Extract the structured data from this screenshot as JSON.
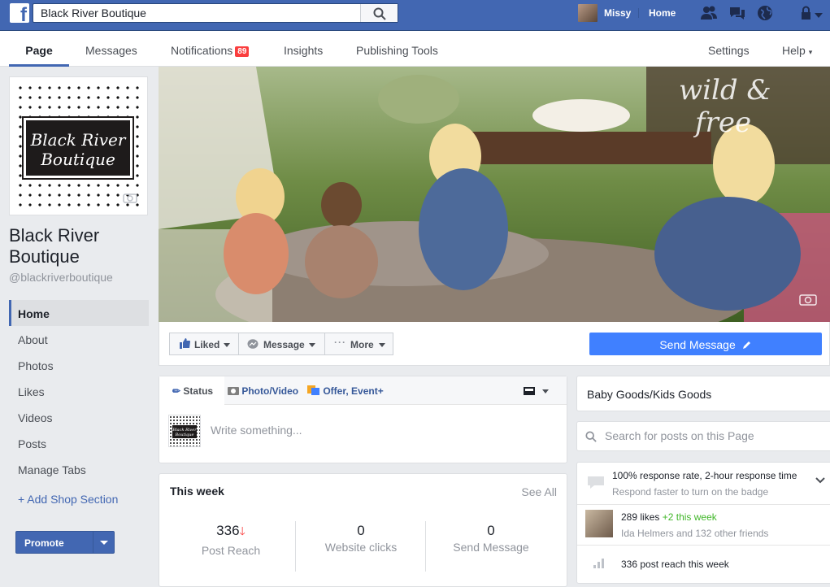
{
  "topbar": {
    "logo": "f",
    "search_value": "Black River Boutique",
    "user_name": "Missy",
    "home_label": "Home"
  },
  "nav": {
    "tabs": {
      "page": "Page",
      "messages": "Messages",
      "notifications": "Notifications",
      "insights": "Insights",
      "publishing_tools": "Publishing Tools",
      "settings": "Settings",
      "help": "Help"
    },
    "notifications_count": "89"
  },
  "profile": {
    "logo_line1": "Black River",
    "logo_line2": "Boutique",
    "title": "Black River Boutique",
    "handle": "@blackriverboutique"
  },
  "sidebar": {
    "items": [
      "Home",
      "About",
      "Photos",
      "Likes",
      "Videos",
      "Posts",
      "Manage Tabs"
    ],
    "add_shop": "+ Add Shop Section",
    "promote": "Promote"
  },
  "actions": {
    "liked": "Liked",
    "message": "Message",
    "more": "More",
    "send_message": "Send Message"
  },
  "composer": {
    "status": "Status",
    "photo_video": "Photo/Video",
    "offer_event": "Offer, Event+",
    "placeholder": "Write something...",
    "thumb_text": "Black River Boutique"
  },
  "this_week": {
    "title": "This week",
    "see_all": "See All",
    "stats": [
      {
        "value": "336",
        "label": "Post Reach"
      },
      {
        "value": "0",
        "label": "Website clicks"
      },
      {
        "value": "0",
        "label": "Send Message"
      }
    ]
  },
  "right": {
    "category": "Baby Goods/Kids Goods",
    "search_placeholder": "Search for posts on this Page",
    "response_line1": "100% response rate, 2-hour response time",
    "response_line2": "Respond faster to turn on the badge",
    "likes_count": "289 likes",
    "likes_week": "+2 this week",
    "likes_friends": "Ida Helmers and 132 other friends",
    "reach": "336 post reach this week"
  },
  "colors": {
    "brand": "#4267b2",
    "send_button": "#4080ff",
    "badge": "#fa3e3e",
    "positive": "#42b72a",
    "down_arrow": "#fa3e3e"
  }
}
